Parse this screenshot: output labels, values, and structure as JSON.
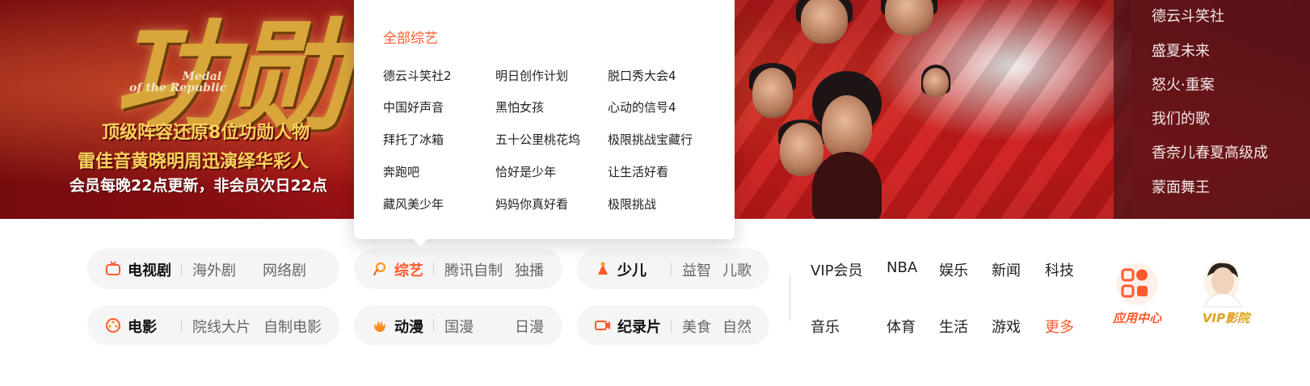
{
  "hero": {
    "title_art": "功勋",
    "medal_line1": "Medal",
    "medal_line2": "of the Republic",
    "headline1": "顶级阵容还原8位功勋人物",
    "headline2": "雷佳音黄晓明周迅演绎华彩人",
    "headline3": "会员每晚22点更新，非会员次日22点",
    "side_list": [
      "德云斗笑社",
      "盛夏未来",
      "怒火·重案",
      "我们的歌",
      "香奈儿春夏高级成",
      "蒙面舞王"
    ]
  },
  "dropdown": {
    "all_label": "全部综艺",
    "items": [
      "德云斗笑社2",
      "明日创作计划",
      "脱口秀大会4",
      "中国好声音",
      "黑怕女孩",
      "心动的信号4",
      "拜托了冰箱",
      "五十公里桃花坞",
      "极限挑战宝藏行",
      "奔跑吧",
      "恰好是少年",
      "让生活好看",
      "藏风美少年",
      "妈妈你真好看",
      "极限挑战"
    ]
  },
  "channels": [
    {
      "icon": "tv-icon",
      "label": "电视剧",
      "subs": [
        "海外剧",
        "网络剧"
      ],
      "active": false
    },
    {
      "icon": "variety-icon",
      "label": "综艺",
      "subs": [
        "腾讯自制",
        "独播"
      ],
      "active": true
    },
    {
      "icon": "kids-icon",
      "label": "少儿",
      "subs": [
        "益智",
        "儿歌"
      ],
      "active": false
    },
    {
      "icon": "movie-icon",
      "label": "电影",
      "subs": [
        "院线大片",
        "自制电影"
      ],
      "active": false
    },
    {
      "icon": "anime-icon",
      "label": "动漫",
      "subs": [
        "国漫",
        "日漫"
      ],
      "active": false
    },
    {
      "icon": "documentary-icon",
      "label": "纪录片",
      "subs": [
        "美食",
        "自然"
      ],
      "active": false
    }
  ],
  "links": {
    "row1": [
      "VIP会员",
      "NBA",
      "娱乐",
      "新闻",
      "科技"
    ],
    "row2": [
      "音乐",
      "体育",
      "生活",
      "游戏",
      "更多"
    ]
  },
  "apps": {
    "app_center": "应用中心",
    "vip_cinema": "VIP影院"
  },
  "colors": {
    "accent": "#ff5a2d",
    "vip_gold": "#e0a020",
    "pill_bg": "#f5f5f5"
  }
}
